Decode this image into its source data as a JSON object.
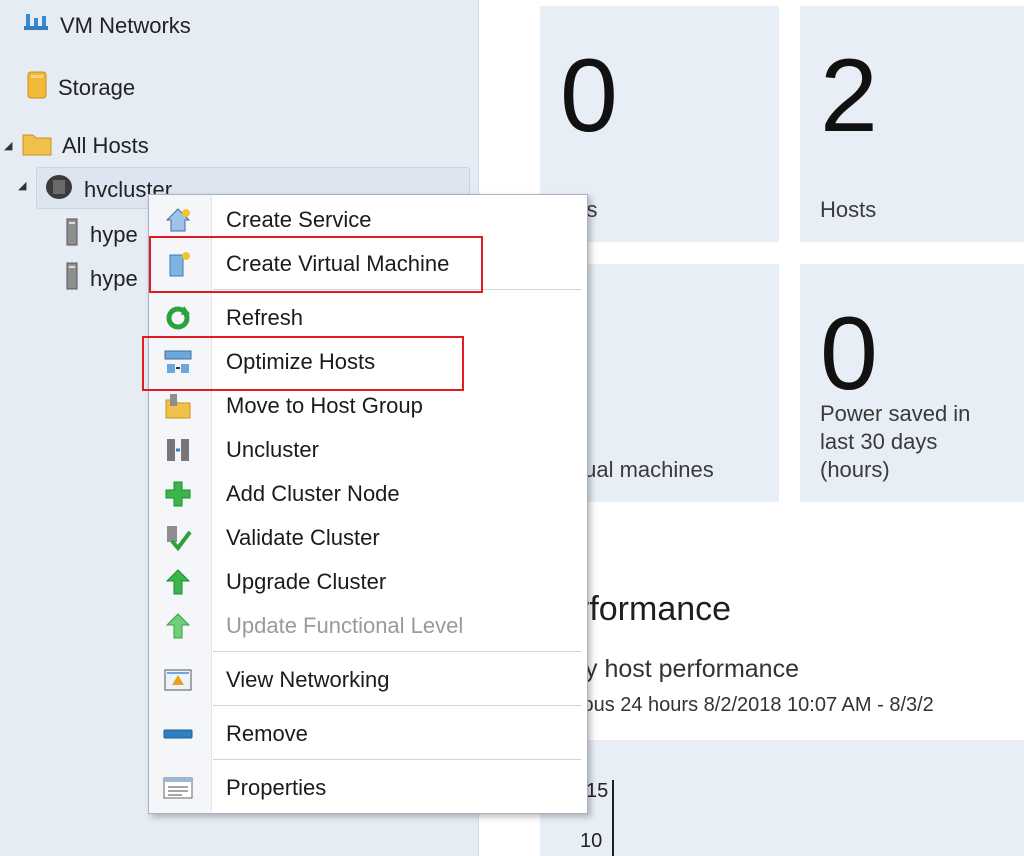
{
  "nav": {
    "items": [
      {
        "label": "VM Networks"
      },
      {
        "label": "Storage"
      },
      {
        "label": "All Hosts"
      },
      {
        "label": "hvcluster"
      },
      {
        "label": "hype"
      },
      {
        "label": "hype"
      }
    ]
  },
  "tiles": [
    {
      "value": "0",
      "caption": "rvices"
    },
    {
      "value": "2",
      "caption": "Hosts"
    },
    {
      "value": "",
      "caption": "tual machines"
    },
    {
      "value": "0",
      "caption_lines": [
        "Power saved in",
        "last 30 days",
        "(hours)"
      ]
    }
  ],
  "performance": {
    "title": "rformance",
    "subtitle": "y host performance",
    "range": "ious 24 hours  8/2/2018 10:07 AM - 8/3/2"
  },
  "chart_data": {
    "type": "line",
    "yticks": [
      "15",
      "10"
    ]
  },
  "context_menu": {
    "items": [
      {
        "label": "Create Service",
        "icon": "create-service-icon"
      },
      {
        "label": "Create Virtual Machine",
        "icon": "create-vm-icon",
        "highlighted": true
      },
      {
        "label": "Refresh",
        "icon": "refresh-icon"
      },
      {
        "label": "Optimize Hosts",
        "icon": "optimize-hosts-icon",
        "highlighted": true
      },
      {
        "label": "Move to Host Group",
        "icon": "move-host-group-icon"
      },
      {
        "label": "Uncluster",
        "icon": "uncluster-icon"
      },
      {
        "label": "Add Cluster Node",
        "icon": "add-node-icon"
      },
      {
        "label": "Validate Cluster",
        "icon": "validate-cluster-icon"
      },
      {
        "label": "Upgrade Cluster",
        "icon": "upgrade-cluster-icon"
      },
      {
        "label": "Update Functional Level",
        "icon": "update-level-icon",
        "disabled": true
      },
      {
        "label": "View Networking",
        "icon": "view-networking-icon"
      },
      {
        "label": "Remove",
        "icon": "remove-icon"
      },
      {
        "label": "Properties",
        "icon": "properties-icon"
      }
    ]
  },
  "colors": {
    "highlight_box": "#e11b22",
    "nav_bg": "#e6ecf4",
    "tile_bg": "#e8eef5"
  }
}
